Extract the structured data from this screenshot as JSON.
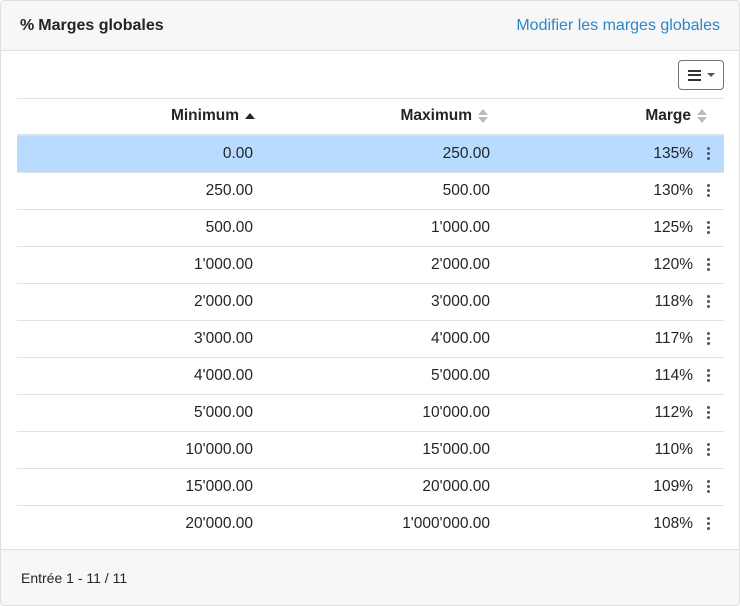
{
  "header": {
    "icon": "percent-icon",
    "title": "Marges globales",
    "edit_link": "Modifier les marges globales"
  },
  "toolbar": {
    "columns_button_icon": "list-icon"
  },
  "table": {
    "columns": [
      {
        "label": "Minimum",
        "sort": "asc"
      },
      {
        "label": "Maximum",
        "sort": "none"
      },
      {
        "label": "Marge",
        "sort": "none"
      }
    ],
    "selected_row": 0,
    "rows": [
      {
        "min": "0.00",
        "max": "250.00",
        "marge": "135%"
      },
      {
        "min": "250.00",
        "max": "500.00",
        "marge": "130%"
      },
      {
        "min": "500.00",
        "max": "1'000.00",
        "marge": "125%"
      },
      {
        "min": "1'000.00",
        "max": "2'000.00",
        "marge": "120%"
      },
      {
        "min": "2'000.00",
        "max": "3'000.00",
        "marge": "118%"
      },
      {
        "min": "3'000.00",
        "max": "4'000.00",
        "marge": "117%"
      },
      {
        "min": "4'000.00",
        "max": "5'000.00",
        "marge": "114%"
      },
      {
        "min": "5'000.00",
        "max": "10'000.00",
        "marge": "112%"
      },
      {
        "min": "10'000.00",
        "max": "15'000.00",
        "marge": "110%"
      },
      {
        "min": "15'000.00",
        "max": "20'000.00",
        "marge": "109%"
      },
      {
        "min": "20'000.00",
        "max": "1'000'000.00",
        "marge": "108%"
      }
    ]
  },
  "footer": {
    "pagination_text": "Entrée 1 - 11 / 11"
  },
  "colors": {
    "link": "#2b87c7",
    "selected_row": "#b8dbff",
    "header_bg": "#f7f7f7"
  }
}
